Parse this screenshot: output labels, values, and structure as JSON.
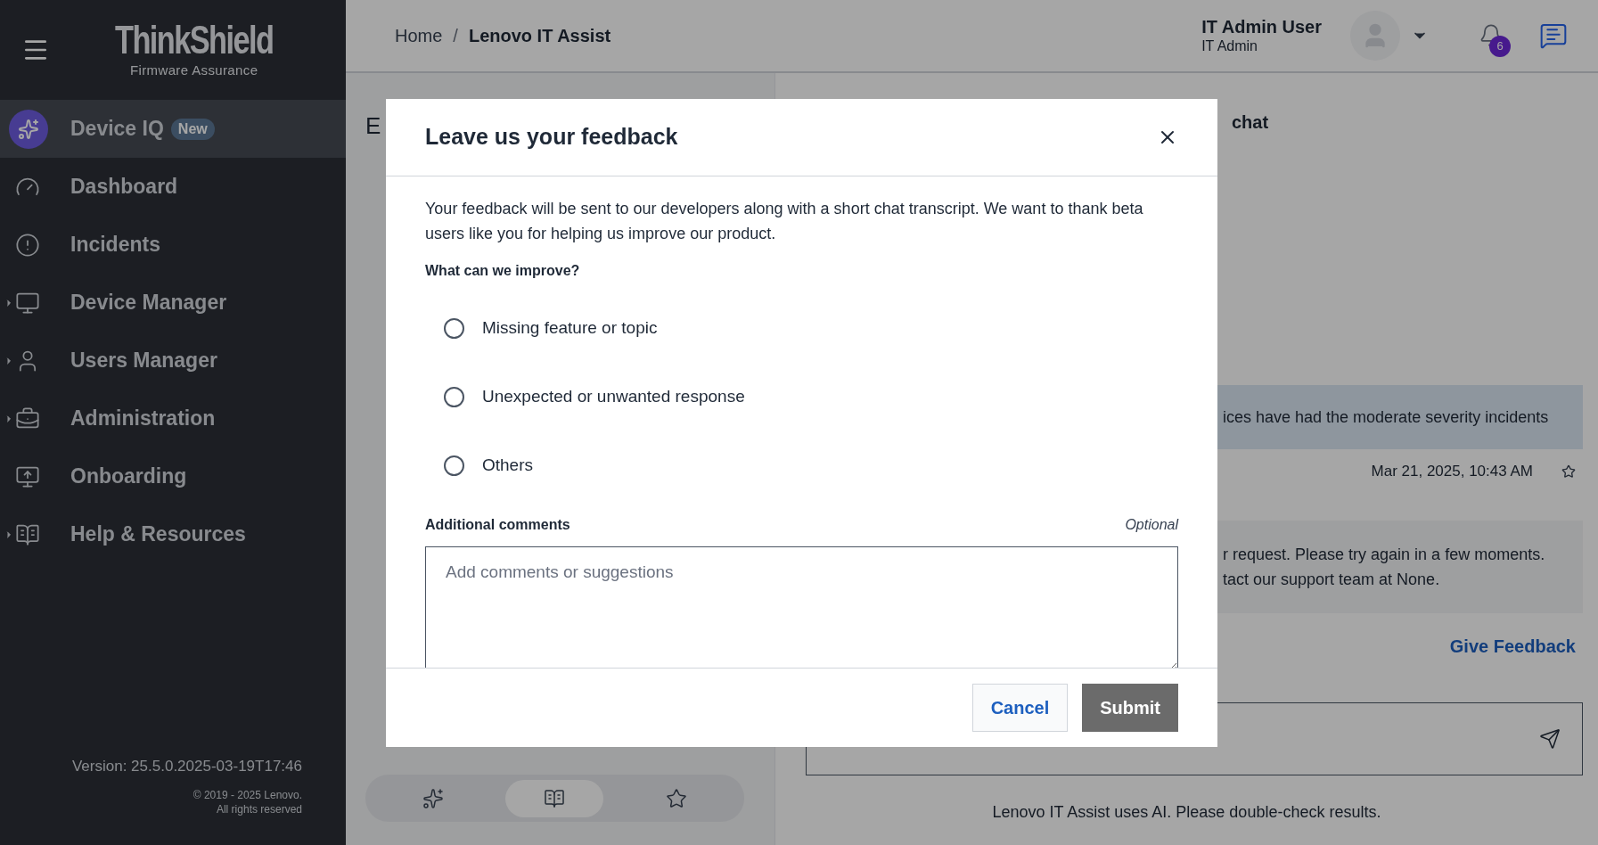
{
  "sidebar": {
    "logo": {
      "title": "ThinkShield",
      "subtitle": "Firmware Assurance"
    },
    "items": [
      {
        "label": "Device IQ",
        "badge": "New",
        "selected": true,
        "kind": "link"
      },
      {
        "label": "Dashboard",
        "selected": false,
        "kind": "link"
      },
      {
        "label": "Incidents",
        "selected": false,
        "kind": "link"
      },
      {
        "label": "Device Manager",
        "selected": false,
        "kind": "group"
      },
      {
        "label": "Users Manager",
        "selected": false,
        "kind": "group"
      },
      {
        "label": "Administration",
        "selected": false,
        "kind": "group"
      },
      {
        "label": "Onboarding",
        "selected": false,
        "kind": "link"
      },
      {
        "label": "Help & Resources",
        "selected": false,
        "kind": "group"
      }
    ],
    "version": "Version: 25.5.0.2025-03-19T17:46",
    "copyright": [
      "© 2019 - 2025 Lenovo.",
      "All rights reserved"
    ]
  },
  "header": {
    "breadcrumbs": [
      "Home",
      "Lenovo IT Assist"
    ],
    "separator": "/",
    "user": {
      "name": "IT Admin User",
      "role": "IT Admin"
    },
    "notifications": "6"
  },
  "left_panel": {
    "title": "E",
    "tabs": [
      {
        "selected": false
      },
      {
        "selected": true
      },
      {
        "selected": false
      }
    ]
  },
  "chat": {
    "title": "chat",
    "user_message": "ices have had the moderate severity incidents",
    "timestamp": "Mar 21, 2025, 10:43 AM",
    "bot_message": [
      "r request. Please try again in a few moments.",
      "tact our support team at None."
    ],
    "feedback_link": "Give Feedback",
    "disclaimer": "Lenovo IT Assist uses AI. Please double-check results."
  },
  "modal": {
    "title": "Leave us your feedback",
    "description": "Your feedback will be sent to our developers along with a short chat transcript. We want to thank beta users like you for helping us improve our product.",
    "question": "What can we improve?",
    "options": [
      {
        "label": "Missing feature or topic",
        "selected": false
      },
      {
        "label": "Unexpected or unwanted response",
        "selected": false
      },
      {
        "label": "Others",
        "selected": false
      }
    ],
    "comments_label": "Additional comments",
    "optional": "Optional",
    "placeholder": "Add comments or suggestions",
    "cancel": "Cancel",
    "submit": "Submit"
  }
}
